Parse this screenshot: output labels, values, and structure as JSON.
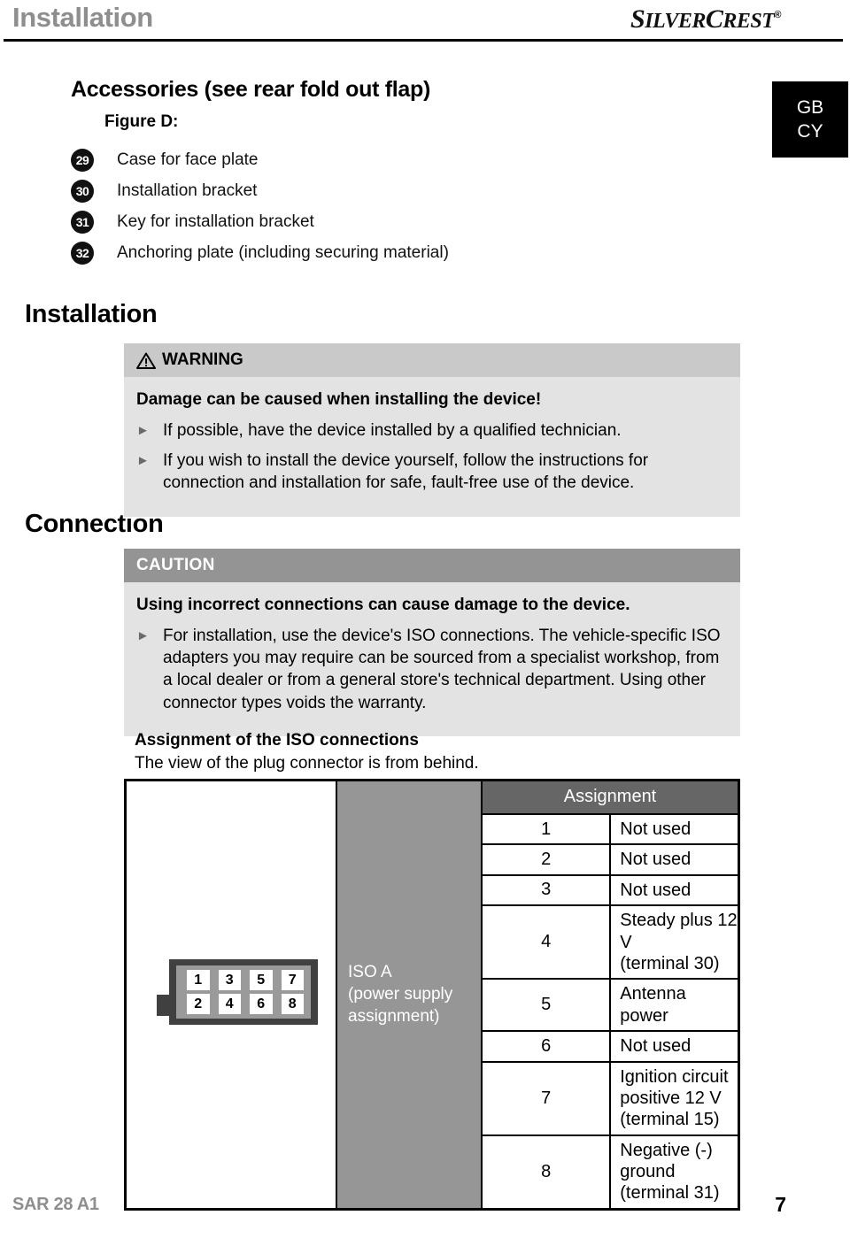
{
  "header": {
    "section_title": "Installation",
    "brand_main": "S",
    "brand_silver": "ILVER",
    "brand_c": "C",
    "brand_rest": "REST",
    "brand_registered": "®"
  },
  "lang_badge": {
    "line1": "GB",
    "line2": "CY"
  },
  "accessories": {
    "title": "Accessories (see rear fold out flap)",
    "figure_label": "Figure D:",
    "items": [
      {
        "num": "29",
        "label": "Case for face plate"
      },
      {
        "num": "30",
        "label": "Installation bracket"
      },
      {
        "num": "31",
        "label": "Key for installation bracket"
      },
      {
        "num": "32",
        "label": "Anchoring plate (including securing material)"
      }
    ]
  },
  "sections": {
    "installation_heading": "Installation",
    "connection_heading": "Connection"
  },
  "warning": {
    "label": "WARNING",
    "lead": "Damage can be caused when installing the device!",
    "bullets": [
      "If possible, have the device installed by a qualified technician.",
      "If you wish to install the device yourself, follow the instructions for connection and installation for safe, fault-free use of the device."
    ]
  },
  "caution": {
    "label": "CAUTION",
    "lead": "Using incorrect connections can cause damage to the device.",
    "bullets": [
      "For installation, use the device's ISO connections. The vehicle-specific ISO adapters you may require can be sourced from a specialist workshop, from a local dealer or from a general store's technical department. Using other connector types voids the warranty."
    ]
  },
  "assignment": {
    "title": "Assignment of the ISO connections",
    "subtitle": "The view of the plug connector is from behind.",
    "connector_label": "ISO A\n(power supply\nassignment)",
    "connector_label_l1": "ISO A",
    "connector_label_l2": "(power supply",
    "connector_label_l3": "assignment)",
    "connector_pins": [
      "1",
      "3",
      "5",
      "7",
      "2",
      "4",
      "6",
      "8"
    ],
    "column_header": "Assignment",
    "rows": [
      {
        "pin": "1",
        "value": "Not used"
      },
      {
        "pin": "2",
        "value": "Not used"
      },
      {
        "pin": "3",
        "value": "Not used"
      },
      {
        "pin": "4",
        "value": "Steady plus 12 V\n(terminal 30)",
        "l1": "Steady plus 12 V",
        "l2": "(terminal 30)"
      },
      {
        "pin": "5",
        "value": "Antenna power"
      },
      {
        "pin": "6",
        "value": "Not used"
      },
      {
        "pin": "7",
        "value": "Ignition circuit positive 12 V\n(terminal 15)",
        "l1": "Ignition circuit positive 12 V",
        "l2": "(terminal 15)"
      },
      {
        "pin": "8",
        "value": "Negative (-)\nground (terminal 31)",
        "l1": "Negative (-)",
        "l2": "ground (terminal 31)"
      }
    ]
  },
  "footer": {
    "model": "SAR 28 A1",
    "page_number": "7"
  },
  "colors": {
    "header_gray": "#8e8e8e",
    "warning_head": "#c9c9c9",
    "notice_body": "#e3e3e3",
    "caution_head": "#949494",
    "table_head": "#666666",
    "iso_cell": "#969696",
    "connector_body": "#404040",
    "connector_inner": "#9a9a9a"
  }
}
